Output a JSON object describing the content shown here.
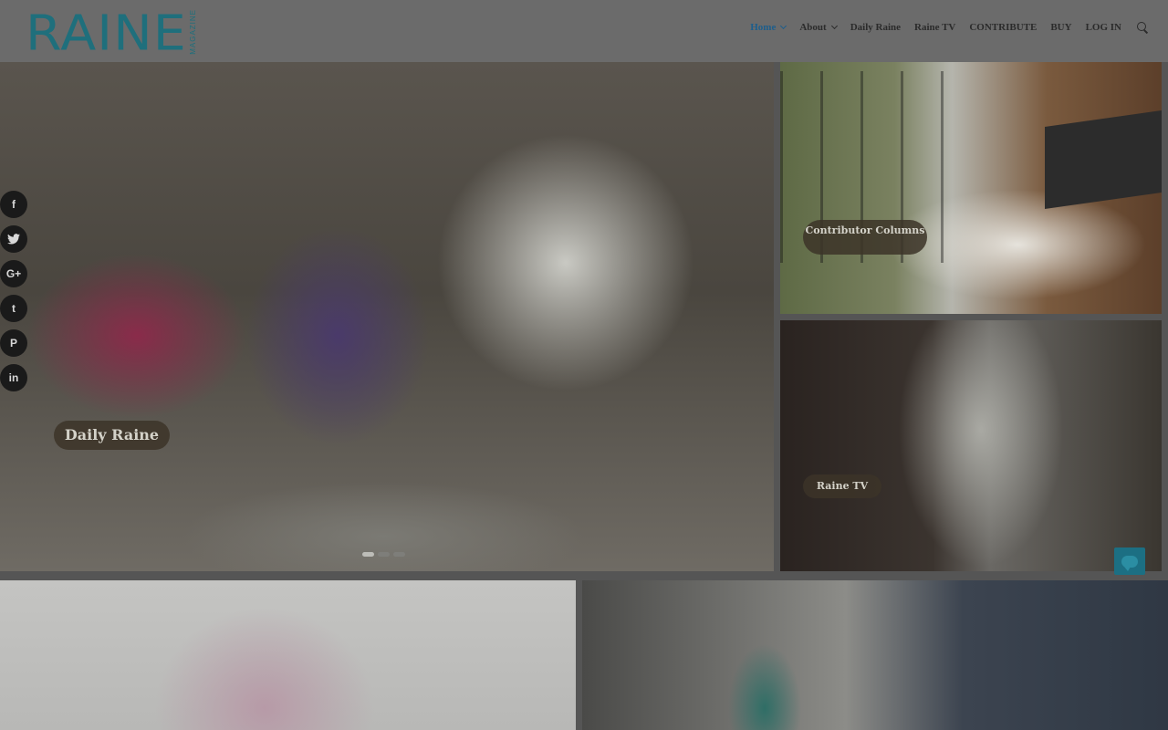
{
  "brand": {
    "name": "RAINE",
    "subtitle": "MAGAZINE"
  },
  "nav": {
    "items": [
      {
        "label": "Home",
        "active": true,
        "dropdown": true
      },
      {
        "label": "About",
        "active": false,
        "dropdown": true
      },
      {
        "label": "Daily Raine",
        "active": false,
        "dropdown": false
      },
      {
        "label": "Raine TV",
        "active": false,
        "dropdown": false
      },
      {
        "label": "CONTRIBUTE",
        "active": false,
        "dropdown": false
      },
      {
        "label": "BUY",
        "active": false,
        "dropdown": false
      },
      {
        "label": "LOG IN",
        "active": false,
        "dropdown": false
      }
    ],
    "search_icon": "search-icon"
  },
  "tiles": {
    "main_caption": "Daily Raine",
    "contrib_caption": "Contributor Columns",
    "tv_caption": "Raine TV"
  },
  "slider": {
    "slide_count": 3,
    "active_slide": 1
  },
  "social": [
    {
      "label": "f",
      "icon": "facebook-icon"
    },
    {
      "label": "t",
      "icon": "twitter-icon",
      "glyph": "🐦"
    },
    {
      "label": "G+",
      "icon": "google-plus-icon"
    },
    {
      "label": "t",
      "icon": "tumblr-icon"
    },
    {
      "label": "P",
      "icon": "pinterest-icon"
    },
    {
      "label": "in",
      "icon": "linkedin-icon"
    }
  ],
  "colors": {
    "brand": "#1f6f7c",
    "nav_active": "#1d5e8c",
    "chat": "#1c6f83"
  }
}
